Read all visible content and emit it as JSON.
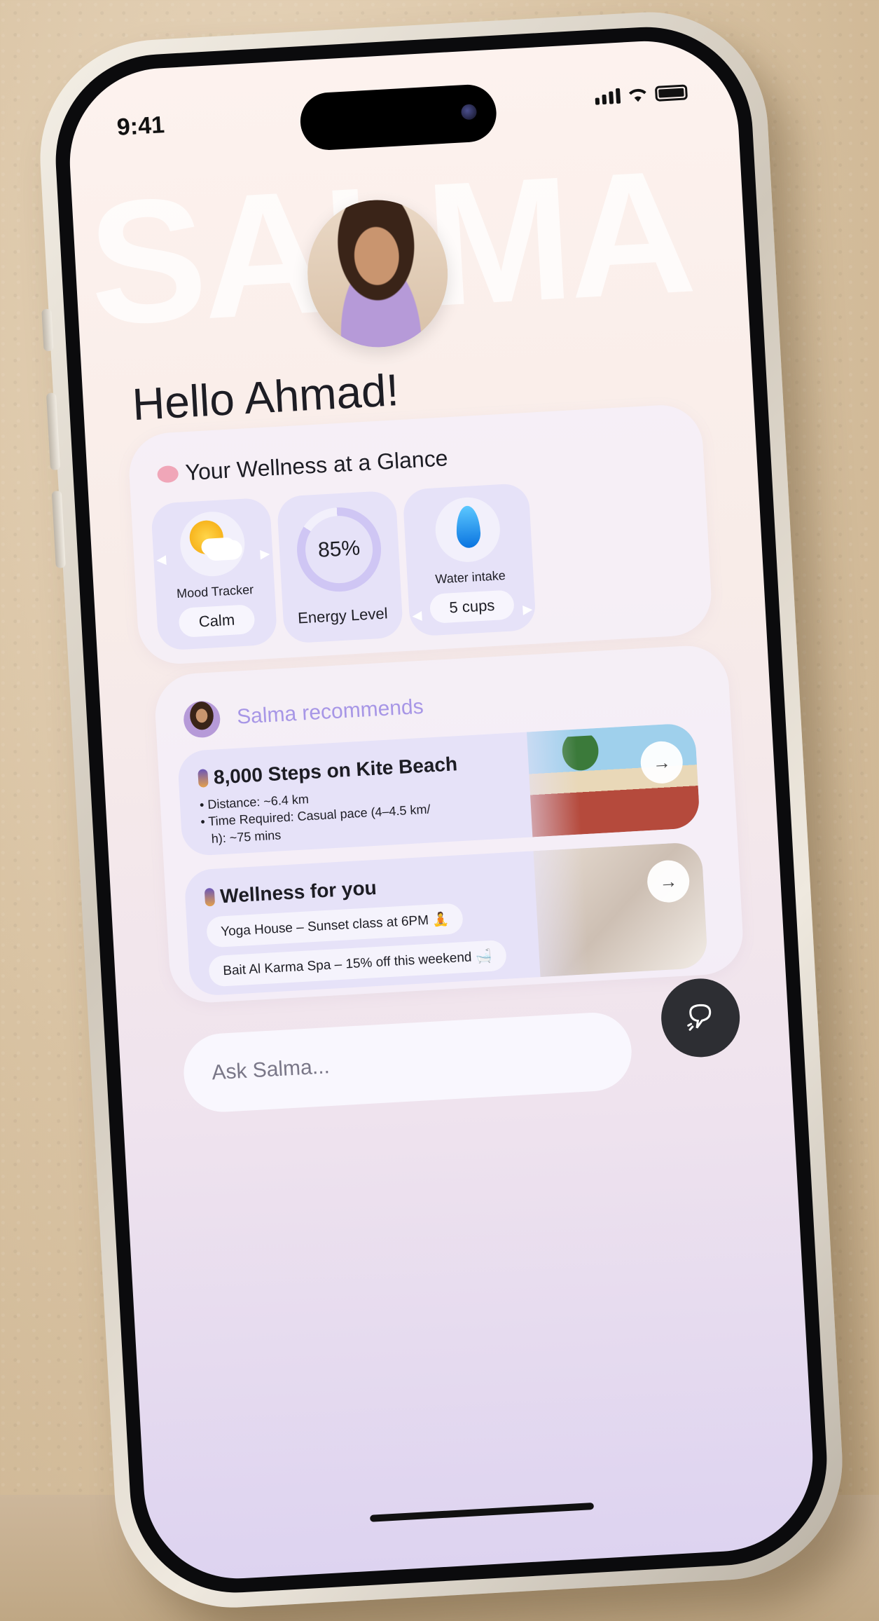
{
  "status": {
    "time": "9:41"
  },
  "hero": {
    "watermark": "SALMA",
    "greeting": "Hello Ahmad!"
  },
  "wellness": {
    "title": "Your Wellness at a Glance",
    "mood": {
      "label": "Mood Tracker",
      "value": "Calm"
    },
    "energy": {
      "label": "Energy Level",
      "value": "85%",
      "level": 0.85
    },
    "water": {
      "label": "Water intake",
      "value": "5 cups"
    }
  },
  "recommend": {
    "title": "Salma recommends",
    "items": [
      {
        "title": "8,000 Steps on Kite Beach",
        "bullets": [
          "Distance: ~6.4 km",
          "Time Required:  Casual pace (4–4.5 km/",
          "h): ~75 mins"
        ]
      },
      {
        "title": "Wellness for you",
        "offers": [
          "Yoga House – Sunset class at 6PM 🧘",
          "Bait Al Karma Spa – 15% off this weekend 🛁"
        ]
      }
    ]
  },
  "ask": {
    "placeholder": "Ask Salma..."
  },
  "colors": {
    "accent": "#a796e6",
    "tile": "#e6e2f8",
    "button": "#2d2e33"
  }
}
